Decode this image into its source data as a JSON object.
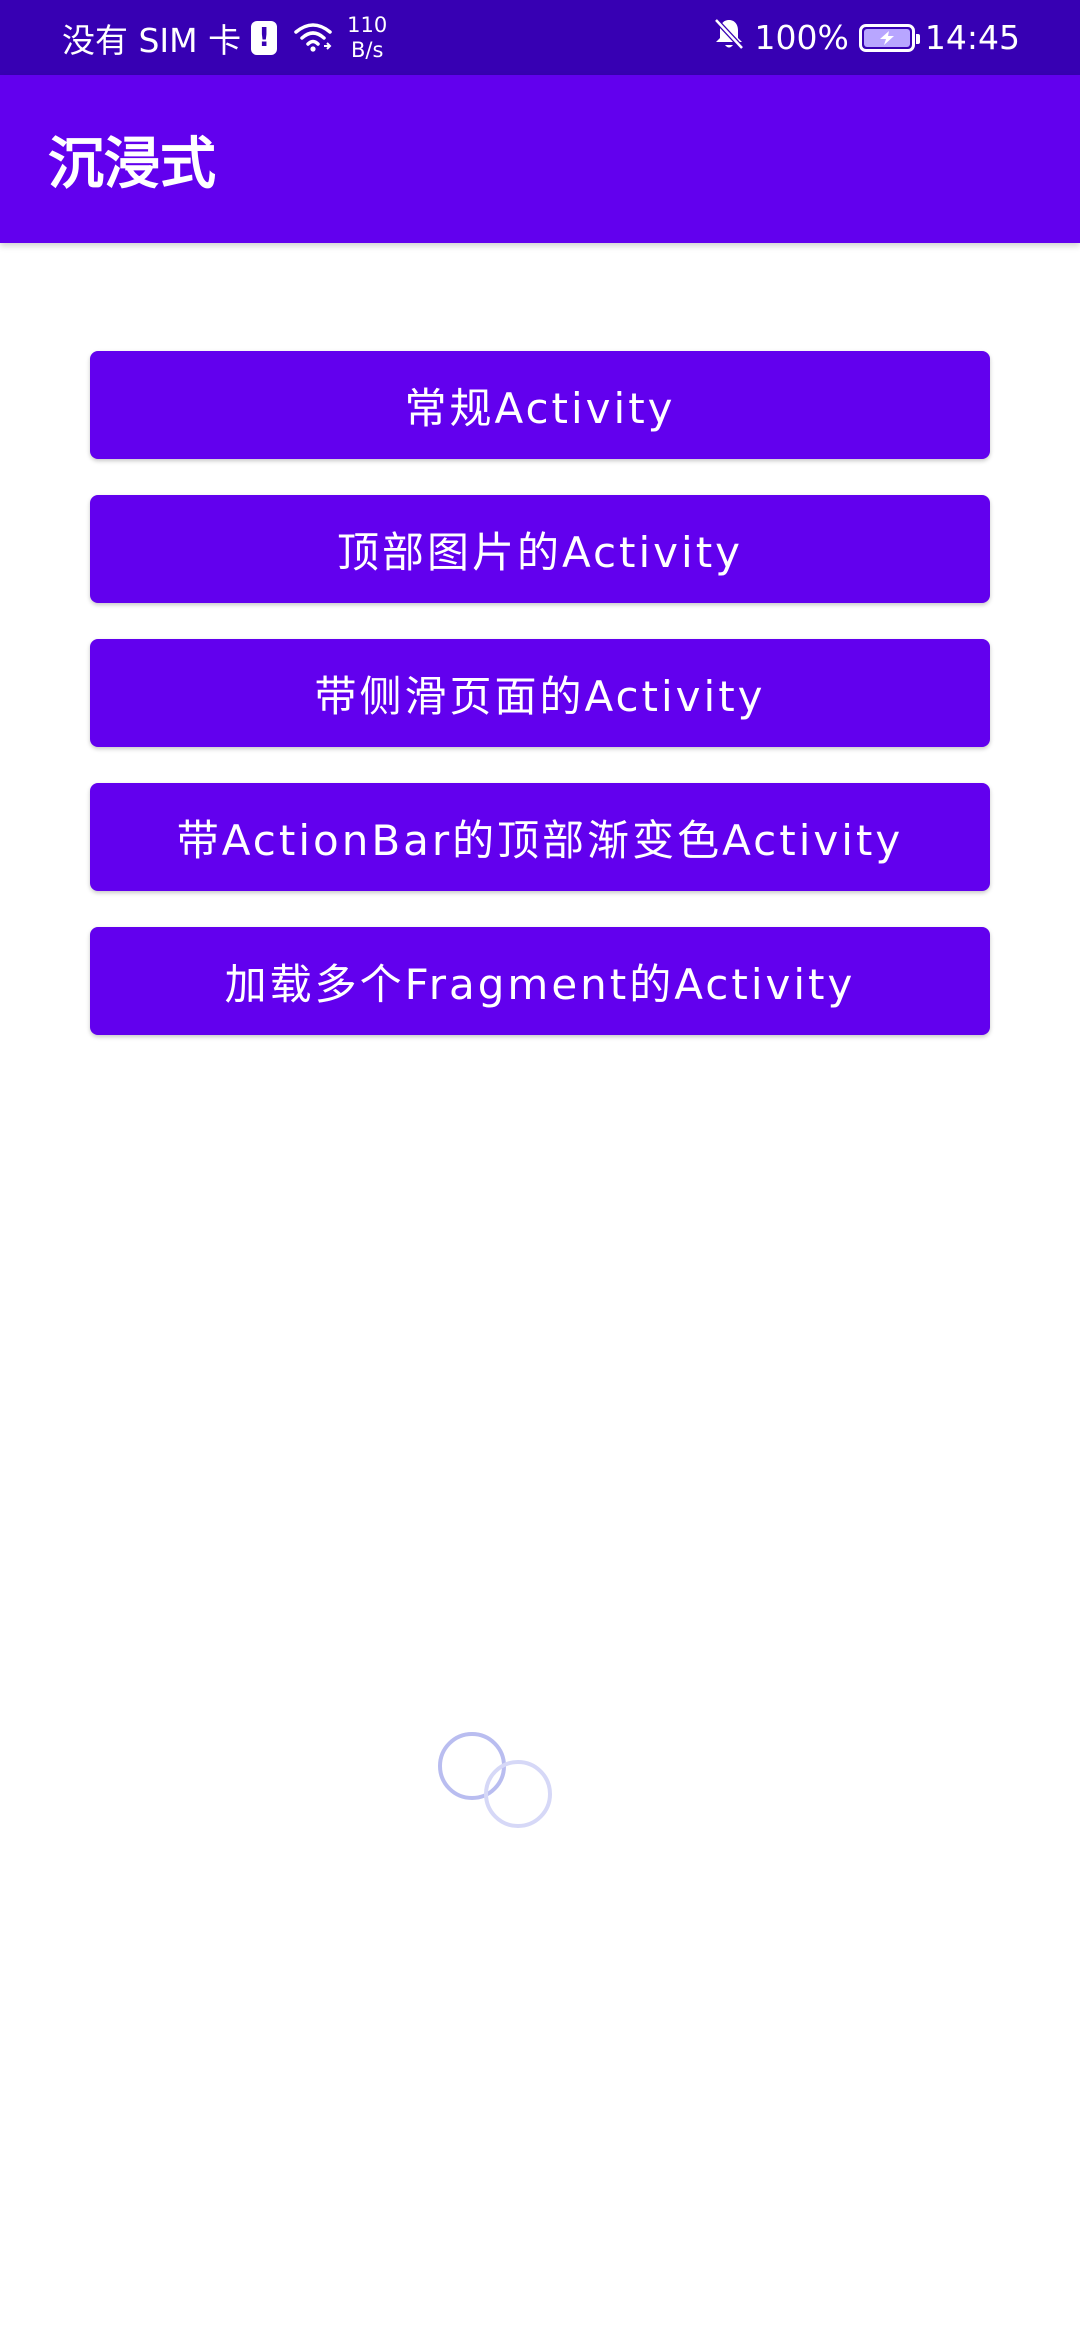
{
  "status_bar": {
    "sim_text": "没有 SIM 卡",
    "sim_alert": "!",
    "net_speed_value": "110",
    "net_speed_unit": "B/s",
    "battery": "100%",
    "time": "14:45",
    "icons": [
      "sim-alert-icon",
      "wifi-icon",
      "mute-bell-icon",
      "battery-charging-icon"
    ]
  },
  "app_bar": {
    "title": "沉浸式"
  },
  "buttons": [
    {
      "label": "常规Activity"
    },
    {
      "label": "顶部图片的Activity"
    },
    {
      "label": "带侧滑页面的Activity"
    },
    {
      "label": "带ActionBar的顶部渐变色Activity"
    },
    {
      "label": "加载多个Fragment的Activity"
    }
  ],
  "colors": {
    "status_bar": "#3700b3",
    "primary": "#6200ee",
    "on_primary": "#ffffff",
    "background": "#ffffff"
  },
  "loader": {
    "icon": "loading-circles-icon"
  }
}
